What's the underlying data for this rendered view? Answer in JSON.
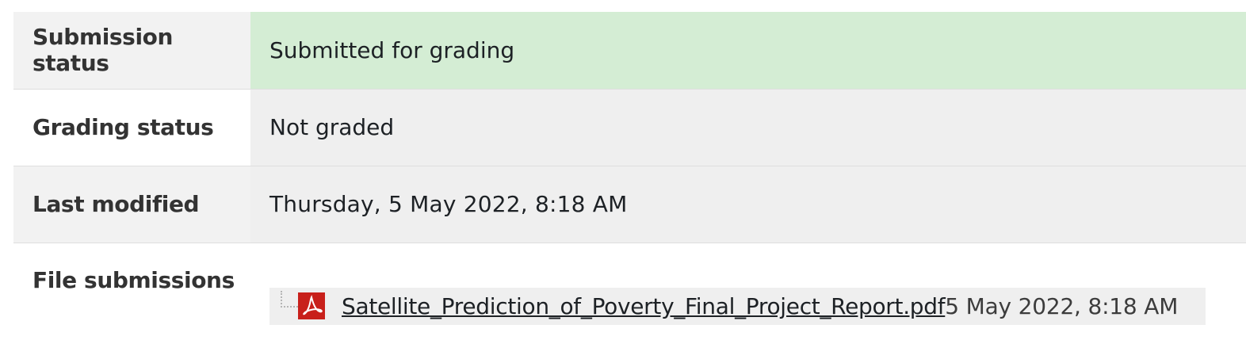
{
  "submission": {
    "rows": [
      {
        "label": "Submission status",
        "value": "Submitted for grading"
      },
      {
        "label": "Grading status",
        "value": "Not graded"
      },
      {
        "label": "Last modified",
        "value": "Thursday, 5 May 2022, 8:18 AM"
      },
      {
        "label": "File submissions"
      }
    ],
    "files": [
      {
        "icon": "pdf-icon",
        "name": "Satellite_Prediction_of_Poverty_Final_Project_Report.pdf",
        "date": "5 May 2022, 8:18 AM"
      }
    ]
  },
  "colors": {
    "submitted_bg": "#d4edd4",
    "label_bg": "#f2f2f2",
    "value_bg": "#efefef",
    "pdf_red": "#c8201b"
  }
}
